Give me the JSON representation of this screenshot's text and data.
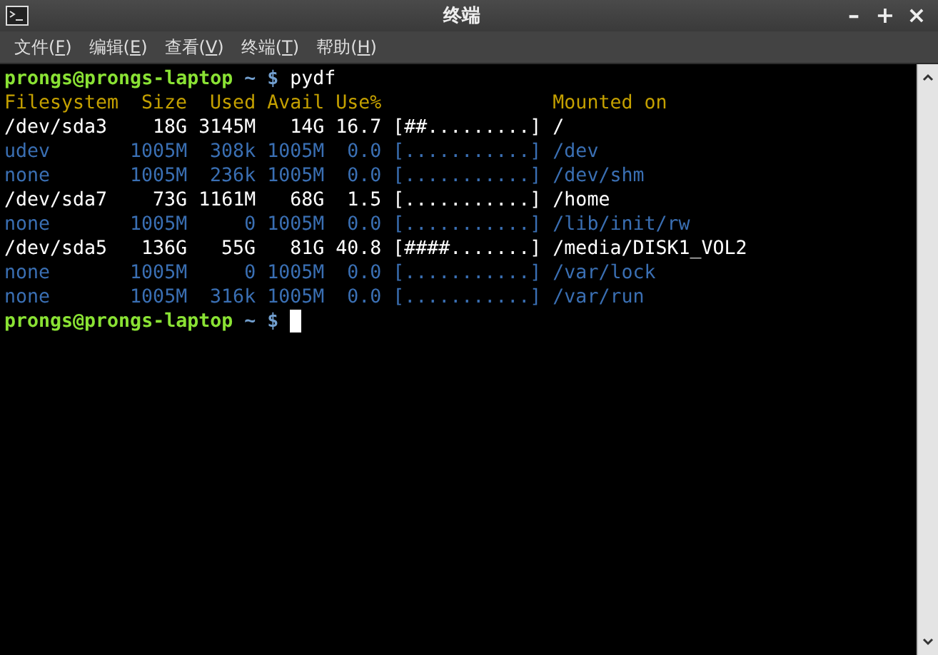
{
  "window": {
    "title": "终端",
    "controls": [
      "–",
      "+",
      "×"
    ]
  },
  "menu": [
    {
      "before": "文件(",
      "accel": "F",
      "after": ")"
    },
    {
      "before": "编辑(",
      "accel": "E",
      "after": ")"
    },
    {
      "before": "查看(",
      "accel": "V",
      "after": ")"
    },
    {
      "before": "终端(",
      "accel": "T",
      "after": ")"
    },
    {
      "before": "帮助(",
      "accel": "H",
      "after": ")"
    }
  ],
  "terminal": {
    "command_prompt": {
      "user_host": "prongs@prongs-laptop",
      "path_sign": "~ $",
      "command": "pydf"
    },
    "header": [
      "Filesystem",
      "Size",
      "Used",
      "Avail",
      "Use%",
      "Mounted on"
    ],
    "rows": [
      {
        "kind": "device",
        "cells": [
          "/dev/sda3",
          "18G",
          "3145M",
          "14G",
          "16.7",
          "[##.........]",
          "/"
        ]
      },
      {
        "kind": "virtual",
        "cells": [
          "udev",
          "1005M",
          "308k",
          "1005M",
          "0.0",
          "[...........]",
          "/dev"
        ]
      },
      {
        "kind": "virtual",
        "cells": [
          "none",
          "1005M",
          "236k",
          "1005M",
          "0.0",
          "[...........]",
          "/dev/shm"
        ]
      },
      {
        "kind": "device",
        "cells": [
          "/dev/sda7",
          "73G",
          "1161M",
          "68G",
          "1.5",
          "[...........]",
          "/home"
        ]
      },
      {
        "kind": "virtual",
        "cells": [
          "none",
          "1005M",
          "0",
          "1005M",
          "0.0",
          "[...........]",
          "/lib/init/rw"
        ]
      },
      {
        "kind": "device",
        "cells": [
          "/dev/sda5",
          "136G",
          "55G",
          "81G",
          "40.8",
          "[####.......]",
          "/media/DISK1_VOL2"
        ]
      },
      {
        "kind": "virtual",
        "cells": [
          "none",
          "1005M",
          "0",
          "1005M",
          "0.0",
          "[...........]",
          "/var/lock"
        ]
      },
      {
        "kind": "virtual",
        "cells": [
          "none",
          "1005M",
          "316k",
          "1005M",
          "0.0",
          "[...........]",
          "/var/run"
        ]
      }
    ],
    "final_prompt": {
      "user_host": "prongs@prongs-laptop",
      "path_sign": "~ $"
    }
  }
}
